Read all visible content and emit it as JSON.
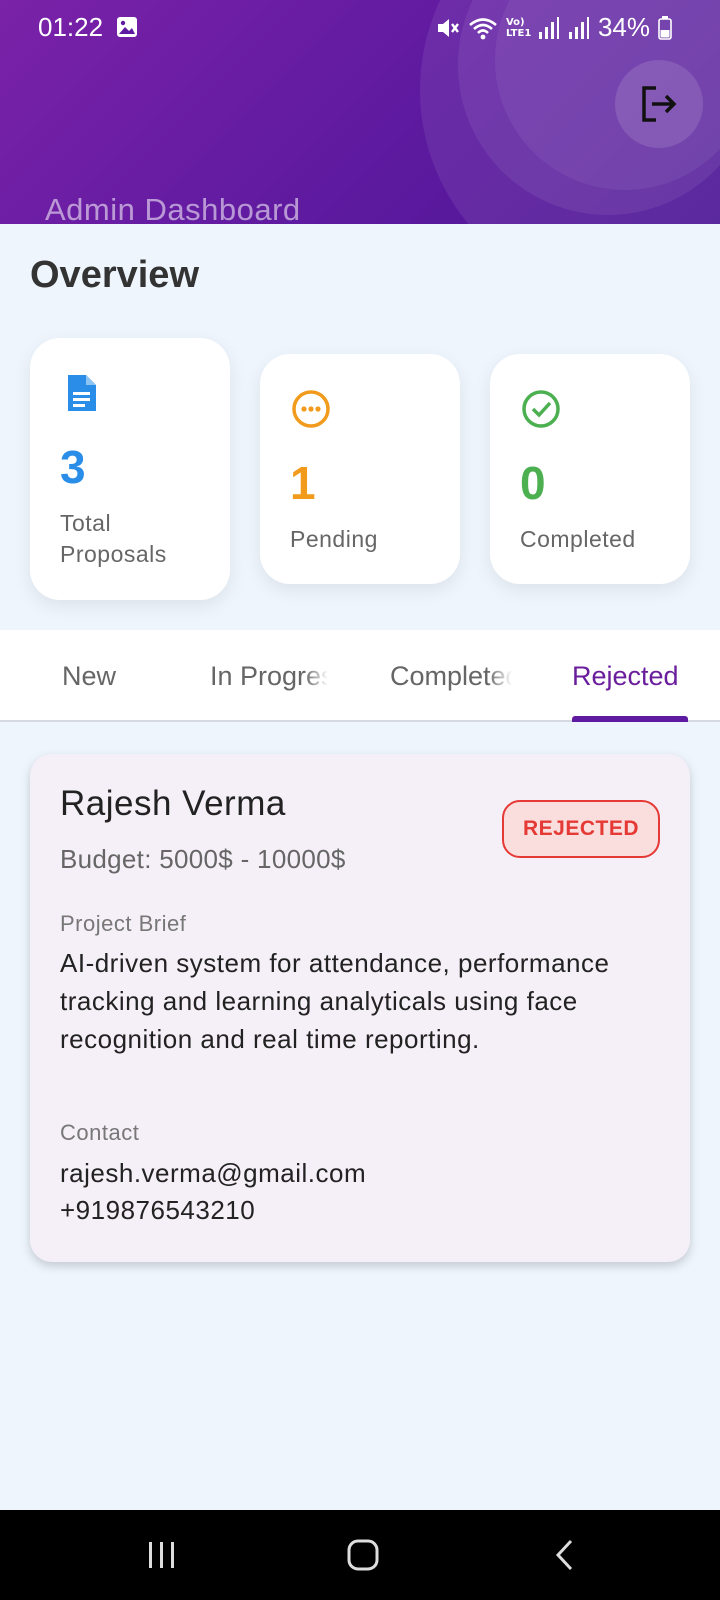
{
  "status_bar": {
    "time": "01:22",
    "battery": "34%",
    "network_label": "Vo) LTE1"
  },
  "header": {
    "title": "Admin Dashboard",
    "logout_icon": "logout-icon"
  },
  "overview": {
    "title": "Overview",
    "cards": [
      {
        "value": "3",
        "label": "Total Proposals",
        "icon": "document-icon",
        "color": "#2A8EE8"
      },
      {
        "value": "1",
        "label": "Pending",
        "icon": "pending-icon",
        "color": "#F29A1B"
      },
      {
        "value": "0",
        "label": "Completed",
        "icon": "check-circle-icon",
        "color": "#4CAF50"
      }
    ]
  },
  "tabs": [
    {
      "label": "New",
      "active": false
    },
    {
      "label": "In Progress",
      "active": false
    },
    {
      "label": "Completed",
      "active": false
    },
    {
      "label": "Rejected",
      "active": true
    }
  ],
  "proposal": {
    "name": "Rajesh Verma",
    "budget": "Budget: 5000$ - 10000$",
    "status": "REJECTED",
    "brief_label": "Project Brief",
    "brief": "AI-driven system for attendance, performance tracking and learning analyticals using face recognition and real time reporting.",
    "contact_label": "Contact",
    "email": "rajesh.verma@gmail.com",
    "phone": "+919876543210"
  },
  "colors": {
    "header_primary": "#6A1E9C",
    "accent": "#5E1AA0",
    "rejected": "#E53935",
    "background": "#EEF5FD"
  }
}
